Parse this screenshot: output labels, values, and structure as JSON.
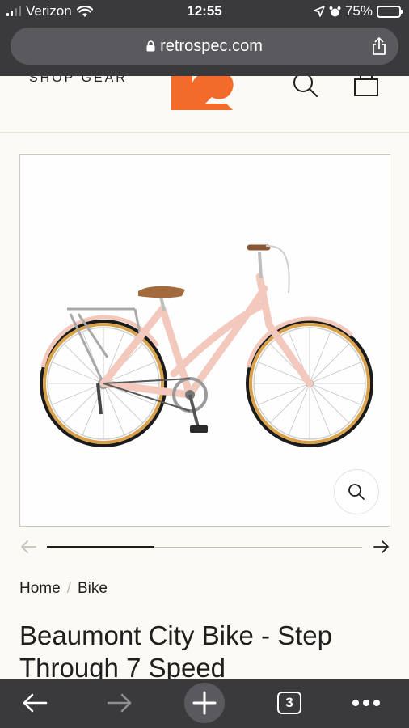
{
  "status_bar": {
    "carrier": "Verizon",
    "time": "12:55",
    "battery": "75%",
    "battery_level": 0.75
  },
  "browser": {
    "url": "retrospec.com",
    "tab_count": "3"
  },
  "header": {
    "menu_label": "SHOP GEAR"
  },
  "gallery": {
    "position": 0.34
  },
  "breadcrumb": {
    "home": "Home",
    "separator": "/",
    "current": "Bike"
  },
  "product": {
    "title": "Beaumont City Bike - Step Through 7 Speed"
  },
  "colors": {
    "brand_orange": "#f26b2a",
    "frame_pink": "#f3c9bd",
    "tire_tan": "#d9a24a",
    "saddle_brown": "#a26a3d"
  },
  "icons": [
    "wifi-icon",
    "location-icon",
    "alarm-icon",
    "lock-icon",
    "share-icon",
    "search-icon",
    "cart-icon",
    "zoom-icon",
    "arrow-left-icon",
    "arrow-right-icon",
    "back-icon",
    "forward-icon",
    "plus-icon",
    "tabs-icon",
    "more-icon"
  ]
}
